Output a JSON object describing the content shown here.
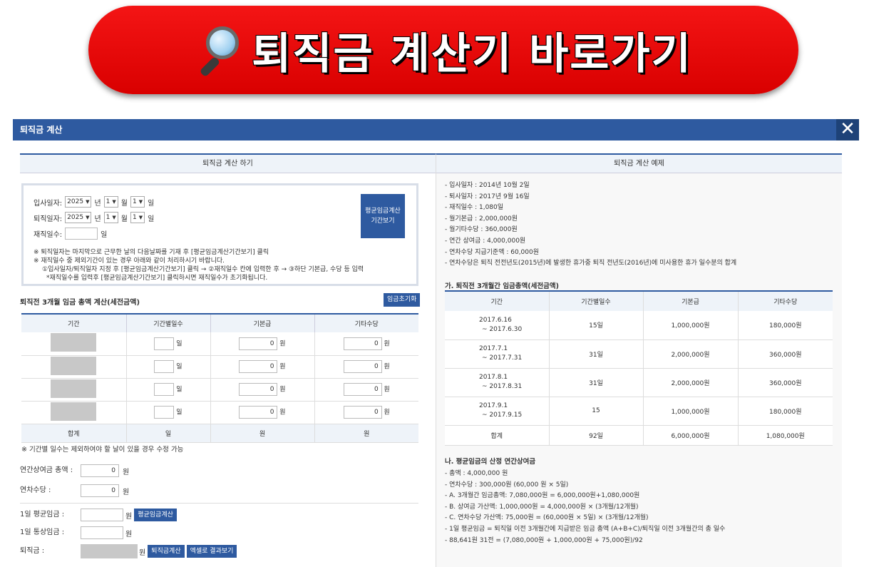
{
  "banner": {
    "text": "퇴직금 계산기 바로가기"
  },
  "modal": {
    "title": "퇴직금 계산",
    "close": "✕"
  },
  "left": {
    "title": "퇴직금 계산 하기",
    "join_label": "입사일자:",
    "leave_label": "퇴직일자:",
    "year": "2025",
    "month": "1",
    "day": "1",
    "year_unit": "년",
    "month_unit": "월",
    "day_unit": "일",
    "work_days_label": "재직일수:",
    "work_days_unit": "일",
    "avg_period_button": "평균임금계산 기간보기",
    "notes": [
      "※ 퇴직일자는 마지막으로 근무한 날의 다음날짜를 기재 후 [평균임금계산기간보기] 클릭",
      "※ 재직일수 중 제외기간이 있는 경우 아래와 같이 처리하시기 바랍니다.",
      "①입사일자/퇴직일자 지정 후 [평균임금계산기간보기] 클릭 → ②재직일수 칸에 입력한 후 → ③하단 기본급, 수당 등 입력",
      "*재직일수를 입력후 [평균임금계산기간보기] 클릭하시면 재직일수가 초기화됩니다."
    ],
    "wage_section_title": "퇴직전 3개월 임금 총액 계산(세전금액)",
    "reset_button": "임금초기화",
    "table_headers": [
      "기간",
      "기간별일수",
      "기본급",
      "기타수당"
    ],
    "row_values": [
      "0",
      "0"
    ],
    "unit_day": "일",
    "unit_won": "원",
    "sum_label": "합계",
    "note_days": "※ 기간별 일수는 제외하여야 할 날이 있을 경우 수정 가능",
    "bonus_label": "연간상여금 총액 :",
    "bonus_value": "0",
    "leave_pay_label": "연차수당 :",
    "leave_pay_value": "0",
    "daily_avg_label": "1일 평균임금 :",
    "daily_avg_button": "평균임금계산",
    "daily_normal_label": "1일 통상임금 :",
    "severance_label": "퇴직금 :",
    "calc_button": "퇴직금계산",
    "excel_button": "엑셀로 결과보기"
  },
  "right": {
    "title": "퇴직금 계산 예제",
    "items": [
      "- 입사일자 : 2014년 10월 2일",
      "- 퇴사일자 : 2017년 9월 16일",
      "- 재직일수 : 1,080일",
      "- 월기본급 : 2,000,000원",
      "- 월기타수당 : 360,000원",
      "- 연간 상여금 : 4,000,000원",
      "- 연차수당 지급기준액 : 60,000원",
      "- 연차수당은 퇴직 전전년도(2015년)에 발생한 휴가중 퇴직 전년도(2016년)에 미사용한 휴가 일수분의 합계"
    ],
    "section_a_title": "가. 퇴직전 3개월간 임금총액(세전금액)",
    "table_headers": [
      "기간",
      "기간별일수",
      "기본급",
      "기타수당"
    ],
    "rows": [
      {
        "from": "2017.6.16",
        "to": "~ 2017.6.30",
        "days": "15일",
        "base": "1,000,000원",
        "other": "180,000원"
      },
      {
        "from": "2017.7.1",
        "to": "~ 2017.7.31",
        "days": "31일",
        "base": "2,000,000원",
        "other": "360,000원"
      },
      {
        "from": "2017.8.1",
        "to": "~ 2017.8.31",
        "days": "31일",
        "base": "2,000,000원",
        "other": "360,000원"
      },
      {
        "from": "2017.9.1",
        "to": "~ 2017.9.15",
        "days": "15",
        "base": "1,000,000원",
        "other": "180,000원"
      }
    ],
    "sum": {
      "label": "합계",
      "days": "92일",
      "base": "6,000,000원",
      "other": "1,080,000원"
    },
    "section_b_title": "나. 평균임금의 산정 연간상여금",
    "calc_items": [
      "- 총액 : 4,000,000 원",
      "- 연차수당 : 300,000원 (60,000 원 × 5일)",
      "- A. 3개월간 임금총액: 7,080,000원 = 6,000,000원+1,080,000원",
      "- B. 상여금 가산액: 1,000,000원 = 4,000,000원 × (3개월/12개월)",
      "- C. 연차수당 가산액: 75,000원 = (60,000원 × 5일) × (3개월/12개월)",
      "- 1일 평균임금 = 퇴직일 이전 3개월간에 지급받은 임금 총액 (A+B+C)/퇴직일 이전 3개월간의 총 일수",
      "- 88,641원 31전 = (7,080,000원 + 1,000,000원 + 75,000원)/92"
    ]
  }
}
